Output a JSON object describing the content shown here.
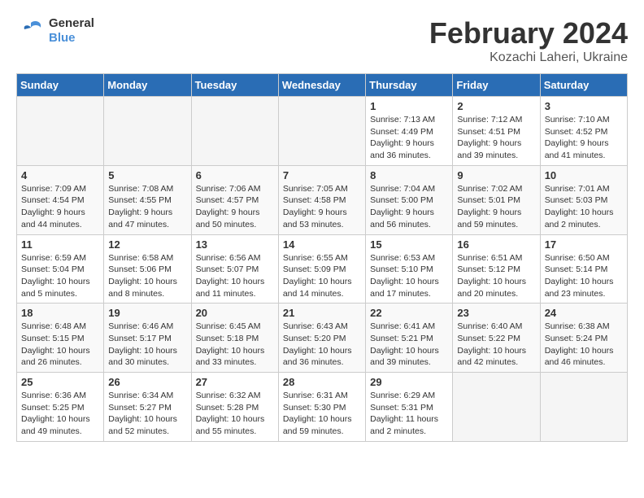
{
  "header": {
    "logo": {
      "general": "General",
      "blue": "Blue"
    },
    "title": "February 2024",
    "location": "Kozachi Laheri, Ukraine"
  },
  "weekdays": [
    "Sunday",
    "Monday",
    "Tuesday",
    "Wednesday",
    "Thursday",
    "Friday",
    "Saturday"
  ],
  "weeks": [
    [
      null,
      null,
      null,
      null,
      {
        "day": "1",
        "sunrise": "7:13 AM",
        "sunset": "4:49 PM",
        "daylight": "9 hours and 36 minutes."
      },
      {
        "day": "2",
        "sunrise": "7:12 AM",
        "sunset": "4:51 PM",
        "daylight": "9 hours and 39 minutes."
      },
      {
        "day": "3",
        "sunrise": "7:10 AM",
        "sunset": "4:52 PM",
        "daylight": "9 hours and 41 minutes."
      }
    ],
    [
      {
        "day": "4",
        "sunrise": "7:09 AM",
        "sunset": "4:54 PM",
        "daylight": "9 hours and 44 minutes."
      },
      {
        "day": "5",
        "sunrise": "7:08 AM",
        "sunset": "4:55 PM",
        "daylight": "9 hours and 47 minutes."
      },
      {
        "day": "6",
        "sunrise": "7:06 AM",
        "sunset": "4:57 PM",
        "daylight": "9 hours and 50 minutes."
      },
      {
        "day": "7",
        "sunrise": "7:05 AM",
        "sunset": "4:58 PM",
        "daylight": "9 hours and 53 minutes."
      },
      {
        "day": "8",
        "sunrise": "7:04 AM",
        "sunset": "5:00 PM",
        "daylight": "9 hours and 56 minutes."
      },
      {
        "day": "9",
        "sunrise": "7:02 AM",
        "sunset": "5:01 PM",
        "daylight": "9 hours and 59 minutes."
      },
      {
        "day": "10",
        "sunrise": "7:01 AM",
        "sunset": "5:03 PM",
        "daylight": "10 hours and 2 minutes."
      }
    ],
    [
      {
        "day": "11",
        "sunrise": "6:59 AM",
        "sunset": "5:04 PM",
        "daylight": "10 hours and 5 minutes."
      },
      {
        "day": "12",
        "sunrise": "6:58 AM",
        "sunset": "5:06 PM",
        "daylight": "10 hours and 8 minutes."
      },
      {
        "day": "13",
        "sunrise": "6:56 AM",
        "sunset": "5:07 PM",
        "daylight": "10 hours and 11 minutes."
      },
      {
        "day": "14",
        "sunrise": "6:55 AM",
        "sunset": "5:09 PM",
        "daylight": "10 hours and 14 minutes."
      },
      {
        "day": "15",
        "sunrise": "6:53 AM",
        "sunset": "5:10 PM",
        "daylight": "10 hours and 17 minutes."
      },
      {
        "day": "16",
        "sunrise": "6:51 AM",
        "sunset": "5:12 PM",
        "daylight": "10 hours and 20 minutes."
      },
      {
        "day": "17",
        "sunrise": "6:50 AM",
        "sunset": "5:14 PM",
        "daylight": "10 hours and 23 minutes."
      }
    ],
    [
      {
        "day": "18",
        "sunrise": "6:48 AM",
        "sunset": "5:15 PM",
        "daylight": "10 hours and 26 minutes."
      },
      {
        "day": "19",
        "sunrise": "6:46 AM",
        "sunset": "5:17 PM",
        "daylight": "10 hours and 30 minutes."
      },
      {
        "day": "20",
        "sunrise": "6:45 AM",
        "sunset": "5:18 PM",
        "daylight": "10 hours and 33 minutes."
      },
      {
        "day": "21",
        "sunrise": "6:43 AM",
        "sunset": "5:20 PM",
        "daylight": "10 hours and 36 minutes."
      },
      {
        "day": "22",
        "sunrise": "6:41 AM",
        "sunset": "5:21 PM",
        "daylight": "10 hours and 39 minutes."
      },
      {
        "day": "23",
        "sunrise": "6:40 AM",
        "sunset": "5:22 PM",
        "daylight": "10 hours and 42 minutes."
      },
      {
        "day": "24",
        "sunrise": "6:38 AM",
        "sunset": "5:24 PM",
        "daylight": "10 hours and 46 minutes."
      }
    ],
    [
      {
        "day": "25",
        "sunrise": "6:36 AM",
        "sunset": "5:25 PM",
        "daylight": "10 hours and 49 minutes."
      },
      {
        "day": "26",
        "sunrise": "6:34 AM",
        "sunset": "5:27 PM",
        "daylight": "10 hours and 52 minutes."
      },
      {
        "day": "27",
        "sunrise": "6:32 AM",
        "sunset": "5:28 PM",
        "daylight": "10 hours and 55 minutes."
      },
      {
        "day": "28",
        "sunrise": "6:31 AM",
        "sunset": "5:30 PM",
        "daylight": "10 hours and 59 minutes."
      },
      {
        "day": "29",
        "sunrise": "6:29 AM",
        "sunset": "5:31 PM",
        "daylight": "11 hours and 2 minutes."
      },
      null,
      null
    ]
  ]
}
